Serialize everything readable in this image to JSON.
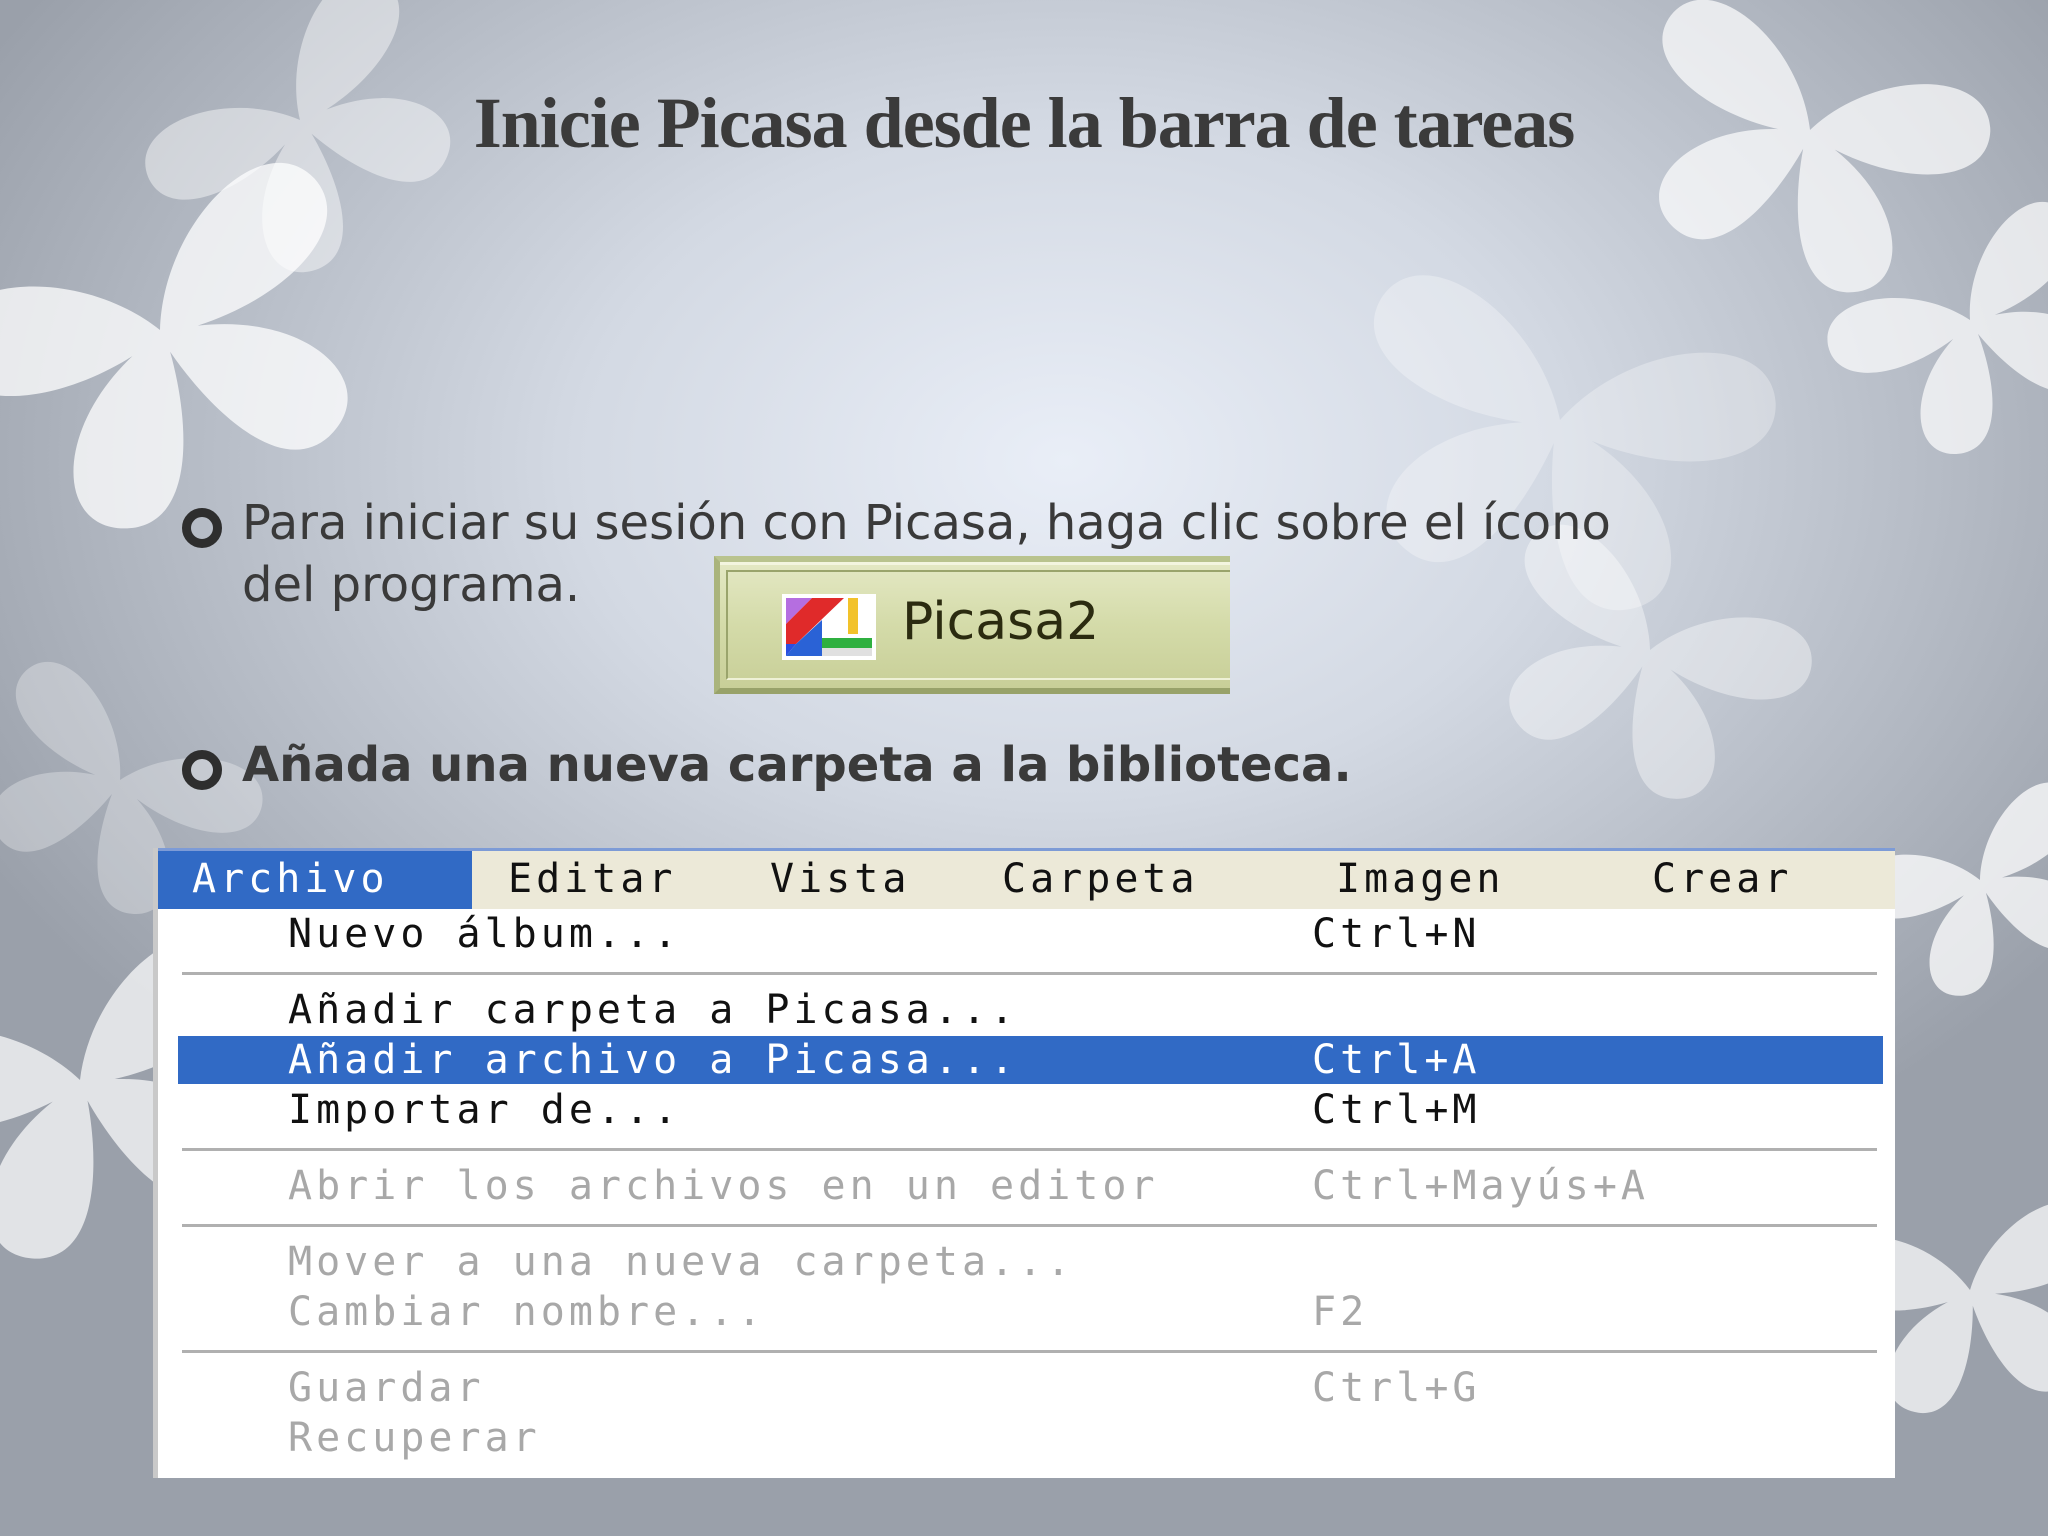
{
  "slide": {
    "title": "Inicie Picasa desde la barra de tareas",
    "bullet1_line1": "Para iniciar su sesión con Picasa, haga clic sobre el ícono",
    "bullet1_line2": "del programa.",
    "bullet2": "Añada una nueva carpeta a la biblioteca."
  },
  "taskbar_button": {
    "label": "Picasa2",
    "icon": "picasa-icon"
  },
  "menubar": {
    "items": [
      "Archivo",
      "Editar",
      "Vista",
      "Carpeta",
      "Imagen",
      "Crear"
    ],
    "active": "Archivo"
  },
  "file_menu": {
    "items": [
      {
        "label": "Nuevo álbum...",
        "shortcut": "Ctrl+N",
        "state": "enabled"
      },
      {
        "label": "Añadir carpeta a Picasa...",
        "shortcut": "",
        "state": "enabled"
      },
      {
        "label": "Añadir archivo a Picasa...",
        "shortcut": "Ctrl+A",
        "state": "selected"
      },
      {
        "label": "Importar de...",
        "shortcut": "Ctrl+M",
        "state": "enabled"
      },
      {
        "label": "Abrir los archivos en un editor",
        "shortcut": "Ctrl+Mayús+A",
        "state": "disabled"
      },
      {
        "label": "Mover a una nueva carpeta...",
        "shortcut": "",
        "state": "disabled"
      },
      {
        "label": "Cambiar nombre...",
        "shortcut": "F2",
        "state": "disabled"
      },
      {
        "label": "Guardar",
        "shortcut": "Ctrl+G",
        "state": "disabled"
      },
      {
        "label": "Recuperar",
        "shortcut": "",
        "state": "disabled"
      }
    ]
  },
  "colors": {
    "selection": "#316ac5",
    "menubar": "#ece9d8",
    "disabled_text": "#a8a8a8",
    "taskbar_button": "#d4dba9"
  }
}
